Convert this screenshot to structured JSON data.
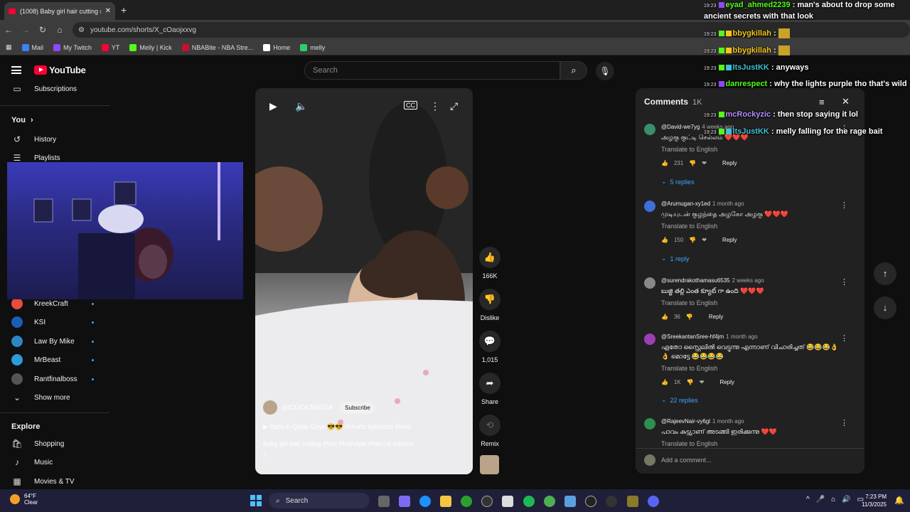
{
  "browser": {
    "tab_title": "(1008) Baby girl hair cutting #ha",
    "url": "youtube.com/shorts/X_cOaojxxvg",
    "bookmarks": [
      {
        "label": "Mail",
        "color": "#3b82f6"
      },
      {
        "label": "My Twitch",
        "color": "#9146ff"
      },
      {
        "label": "YT",
        "color": "#ff0033"
      },
      {
        "label": "Melly | Kick",
        "color": "#53fc18"
      },
      {
        "label": "NBABite - NBA Stre...",
        "color": "#c8102e"
      },
      {
        "label": "Home",
        "color": "#ffffff"
      },
      {
        "label": "melly",
        "color": "#2ecc71"
      }
    ]
  },
  "youtube": {
    "logo": "YouTube",
    "search_placeholder": "Search",
    "sidebar": {
      "subscriptions": "Subscriptions",
      "you": "You",
      "you_chevron": "›",
      "history": "History",
      "playlists": "Playlists",
      "channels": [
        {
          "name": "KreekCraft",
          "color": "#e74c3c"
        },
        {
          "name": "KSI",
          "color": "#1a5fb4"
        },
        {
          "name": "Law By Mike",
          "color": "#2e86c1"
        },
        {
          "name": "MrBeast",
          "color": "#2d9bd8"
        },
        {
          "name": "Rantfinalboss",
          "color": "#555"
        }
      ],
      "show_more": "Show more",
      "explore": "Explore",
      "explore_items": [
        "Shopping",
        "Music",
        "Movies & TV"
      ]
    },
    "short": {
      "channel": "@ICLICKZMEDIA",
      "subscribe": "Subscribe",
      "music": "Back in Qatar Guys 😎😎 #shorts #ytshorts #love",
      "title_prefix": "Baby girl hair cutting ",
      "title_tags": "#hair #hairstyle #haircut #shorts"
    },
    "actions": {
      "likes": "166K",
      "dislike": "Dislike",
      "comments": "1,015",
      "share": "Share",
      "remix": "Remix"
    },
    "comments_panel": {
      "title": "Comments",
      "count": "1K",
      "add_placeholder": "Add a comment...",
      "translate": "Translate to English",
      "reply": "Reply",
      "items": [
        {
          "author": "@David-we7yg",
          "time": "4 weeks ago",
          "text": "அழகு குட்டி செல்லம் ❤️❤️❤️",
          "likes": "231",
          "replies": "5 replies",
          "color": "#3d8c6a"
        },
        {
          "author": "@Arumugan-xy1ed",
          "time": "1 month ago",
          "text": "முடியுடன் குழந்தை அழகோ அழகு ❤️❤️❤️",
          "likes": "150",
          "replies": "1 reply",
          "color": "#3c6fd8"
        },
        {
          "author": "@surendrakothamasu6535",
          "time": "2 weeks ago",
          "text": "బుజ్జి తల్లి ఎంత క్యూట్ గా ఉంది ❤️❤️❤️",
          "likes": "36",
          "replies": "",
          "color": "#888"
        },
        {
          "author": "@SreekantanSree-hf4jm",
          "time": "1 month ago",
          "text": "ഏതോ സ്റ്റൈലിൽ വെട്ടുന്നു എന്നാണ് വിചാരിച്ചത് 😂😂😂👌👌 മൊട്ടേ 😂😂😂😂",
          "likes": "1K",
          "replies": "22 replies",
          "color": "#9b3fb5"
        },
        {
          "author": "@RajeevNair-vy6gl",
          "time": "1 month ago",
          "text": "പാവം കുട്ട്യാണ് അടങ്ങി ഇരിക്കുന്നു ❤️❤️",
          "likes": "",
          "replies": "",
          "color": "#2f8f4e"
        }
      ]
    }
  },
  "chat": [
    {
      "time": "19:23",
      "user": "eyad_ahmed2239",
      "msg": ": man's about to drop some ancient secrets with that look",
      "color": "#53fc18"
    },
    {
      "time": "19:23",
      "user": "bbygkillah",
      "msg": ":",
      "color": "#f5c518"
    },
    {
      "time": "19:23",
      "user": "bbygkillah",
      "msg": ":",
      "color": "#f5c518"
    },
    {
      "time": "19:23",
      "user": "ItsJustKK",
      "msg": ": anyways",
      "color": "#3ec1d3"
    },
    {
      "time": "19:23",
      "user": "danrespect",
      "msg": ": why the lights purple tho that's wild",
      "color": "#53fc18"
    },
    {
      "time": "19:23",
      "user": "mcRockyzic",
      "msg": ": then stop saying it lol",
      "color": "#b48cff"
    },
    {
      "time": "19:23",
      "user": "ItsJustKK",
      "msg": ": melly falling for the rage bait",
      "color": "#3ec1d3"
    }
  ],
  "taskbar": {
    "temp": "64°F",
    "condition": "Clear",
    "search": "Search",
    "time": "7:23 PM",
    "date": "11/3/2025"
  }
}
